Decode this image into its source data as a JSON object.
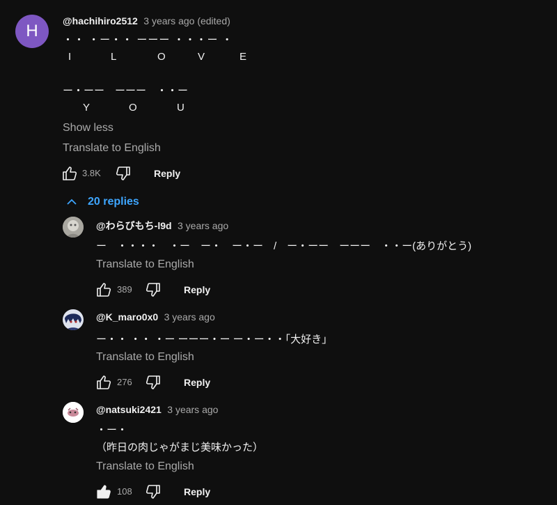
{
  "main_comment": {
    "avatar_letter": "H",
    "avatar_color": "#7e57c2",
    "handle": "@hachihiro2512",
    "time": "3 years ago (edited)",
    "morse_line_1": "・・ ・ー・・ ーーー ・・・ー ・",
    "letters_line_1": [
      "I",
      "L",
      "O",
      "V",
      "E"
    ],
    "morse_line_2": "ー・ーー　ーーー　・・ー",
    "letters_line_2": [
      "Y",
      "O",
      "U"
    ],
    "show_less": "Show less",
    "translate": "Translate to English",
    "like_count": "3.8K",
    "reply": "Reply"
  },
  "replies_toggle": {
    "label": "20 replies",
    "icon": "chevron-up-icon",
    "color": "#3ea6ff"
  },
  "replies": [
    {
      "handle": "@わらびもち-l9d",
      "time": "3 years ago",
      "text": "ー　・・・・　・ー　ー・　ー・ー　/　ー・ーー　ーーー　・・ー(ありがとう)",
      "translate": "Translate to English",
      "like_count": "389",
      "reply": "Reply",
      "liked": false
    },
    {
      "handle": "@K_maro0x0",
      "time": "3 years ago",
      "text": "ー・・ ・・ ・ー ーーー・ー ー・ー・・「大好き」",
      "translate": "Translate to English",
      "like_count": "276",
      "reply": "Reply",
      "liked": false
    },
    {
      "handle": "@natsuki2421",
      "time": "3 years ago",
      "text_line_1": "・ー・",
      "text_line_2": "（昨日の肉じゃがまじ美味かった）",
      "translate": "Translate to English",
      "like_count": "108",
      "reply": "Reply",
      "liked": true
    }
  ]
}
